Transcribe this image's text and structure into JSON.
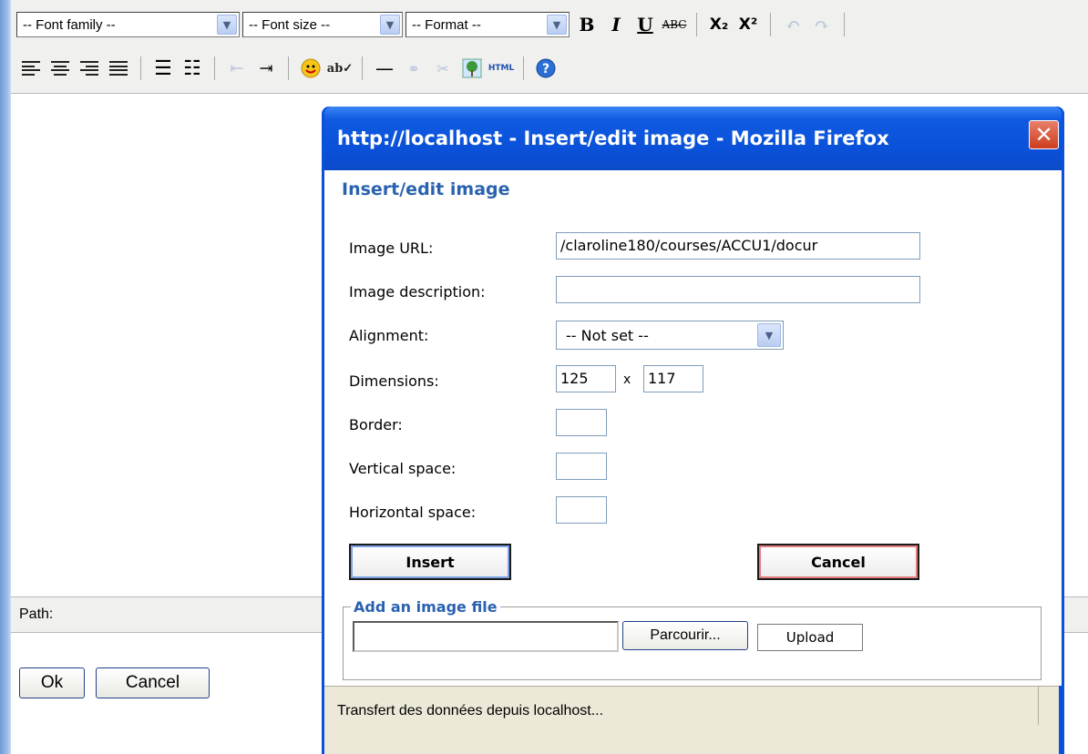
{
  "editor": {
    "toolbar": {
      "font_family": "-- Font family --",
      "font_size": "-- Font size --",
      "format": "-- Format --",
      "bold": "B",
      "italic": "I",
      "underline": "U",
      "strike": "ABC",
      "subscript": "X₂",
      "superscript": "X²",
      "html_label": "HTML"
    },
    "path_label": "Path:"
  },
  "bottom_buttons": {
    "ok": "Ok",
    "cancel": "Cancel"
  },
  "popup": {
    "window_title": "http://localhost - Insert/edit image - Mozilla Firefox",
    "heading": "Insert/edit image",
    "fields": {
      "image_url_label": "Image URL:",
      "image_url_value": "/claroline180/courses/ACCU1/docur",
      "image_description_label": "Image description:",
      "image_description_value": "",
      "alignment_label": "Alignment:",
      "alignment_value": "-- Not set --",
      "dimensions_label": "Dimensions:",
      "width_value": "125",
      "times_sign": "x",
      "height_value": "117",
      "border_label": "Border:",
      "vspace_label": "Vertical space:",
      "hspace_label": "Horizontal space:"
    },
    "insert_button": "Insert",
    "cancel_button": "Cancel",
    "upload_section": {
      "legend": "Add an image file",
      "browse_button": "Parcourir...",
      "upload_button": "Upload"
    },
    "status_text": "Transfert des données depuis localhost..."
  },
  "colors": {
    "titlebar_blue": "#0a52de",
    "heading_blue": "#2a62b0",
    "close_red": "#cd3d1e"
  }
}
